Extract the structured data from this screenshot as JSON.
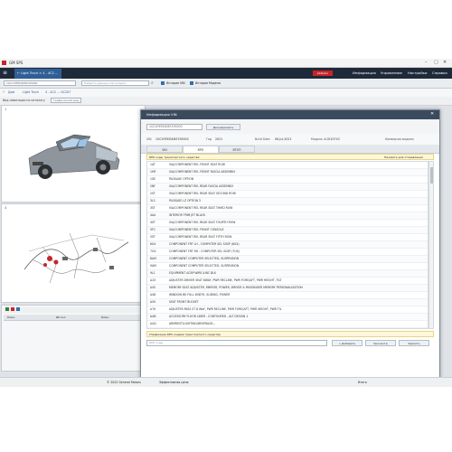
{
  "window": {
    "title": "GM SPS"
  },
  "nav": {
    "tab": "← Light Truck > 4 - 4C2 ...",
    "logo": "ACDelco",
    "items": [
      "Информация",
      "Управление",
      "Настройки",
      "Справка"
    ]
  },
  "toolbar": {
    "vin_value": "1GCUYEED4MZ195000",
    "search_placeholder": "Найдите данные или модели",
    "history_vin": "История VIN",
    "history_mode": "История Модели"
  },
  "breadcrumb": [
    "Дом",
    "Light Truck",
    "4 - 4C2 ... GC207"
  ],
  "view": {
    "label": "Вид навигации по каталогу",
    "value": "Графический вид"
  },
  "panes": {
    "num1": "1",
    "num2": "4"
  },
  "dialog": {
    "title": "Информация VIN",
    "vin_input": "1GCUYEED4MZ195000",
    "decode_button": "Декодировать",
    "info": {
      "vin_label": "VIN",
      "vin_value": "1GCUYEED4MZ195000",
      "year_label": "Год",
      "year_value": "2021",
      "build_label": "Build Date",
      "build_value": "06-Jul-2021",
      "model_label": "Модель",
      "model_value": "4-CK10743",
      "config_label": "Конверсия модели"
    },
    "tabs": [
      "VIN",
      "RPO",
      "ВТОП"
    ],
    "active_tab": 1,
    "yellow_top_text": "RPO коды транспортного средства",
    "yellow_top_right": "Нажмите для отправления",
    "rows": [
      {
        "code": "1AT",
        "desc": "VIA/COMPONENT REL FRONT SEAT ROW"
      },
      {
        "code": "1MF",
        "desc": "VIA/COMPONENT REL FRONT FASCIA ASSEMBLY"
      },
      {
        "code": "1SE",
        "desc": "PACKAGE OPTION"
      },
      {
        "code": "2NF",
        "desc": "VIA/COMPONENT REL REAR FASCIA ASSEMBLY"
      },
      {
        "code": "2ST",
        "desc": "VIA/COMPONENT REL REAR SEAT SECOND ROW"
      },
      {
        "code": "3L2",
        "desc": "PACKAGE LZ OPTION 3"
      },
      {
        "code": "3ST",
        "desc": "VIA/COMPONENT REL REAR SEAT THIRD ROW"
      },
      {
        "code": "4AA",
        "desc": "INTERIOR TRIM JET BLACK"
      },
      {
        "code": "4ST",
        "desc": "VIA/COMPONENT REL REAR SEAT FOURTH ROW"
      },
      {
        "code": "5FC",
        "desc": "VIA/COMPONENT REL FRONT CONSOLE"
      },
      {
        "code": "5ST",
        "desc": "VIA/COMPONENT REL REAR SEAT FIFTH ROW"
      },
      {
        "code": "6UX",
        "desc": "COMPONENT FRT LH - COMPUTER SEL SUSP (6UX)"
      },
      {
        "code": "7GX",
        "desc": "COMPONENT FRT RH - COMPUTER SEL SUSP (7UX)"
      },
      {
        "code": "8AM",
        "desc": "COMPONENT COMPUTER SELECTED, SUSPENSION"
      },
      {
        "code": "9AM",
        "desc": "COMPONENT COMPUTER SELECTED, SUSPENSION"
      },
      {
        "code": "9L1",
        "desc": "EQUIPMENT ACBP WIRE JUNC BLK"
      },
      {
        "code": "A2X",
        "desc": "ADJUSTER DRIVER SEAT 8WAY, PWR RECLINE, PWR FORE/AFT, PWR HEIGHT, TILT"
      },
      {
        "code": "A45",
        "desc": "MEMORY SEAT ADJUSTER, MIRROR, POWER, DRIVER & PASSENGER MEMORY PERSONALIZATION"
      },
      {
        "code": "A48",
        "desc": "WINDOW BK FULL WIDTH, SLIDING, POWER"
      },
      {
        "code": "A50",
        "desc": "SEAT FRONT BUCKET"
      },
      {
        "code": "A7X",
        "desc": "ADJUSTER PASS ST 8 WAY, PWR RECLINE, PWR FORE/AFT, PWR HEIGHT, PWR TIL"
      },
      {
        "code": "AAB",
        "desc": "ACCESSORY FLOOR LINER - CONTOURED - ALT DESIGN 1"
      },
      {
        "code": "AAQ",
        "desc": "ARMREST/LIGHTING/BEVERAGE..."
      }
    ],
    "yellow_bottom_text": "Управление RPO кодами транспортного средства",
    "bottom_input": "RPO коды",
    "buttons": [
      "+ Добавить",
      "Просмотр",
      "Удалить"
    ]
  },
  "bottom_grid": {
    "col1": "Ключ",
    "col2": "RP кол",
    "col3": "Ключ"
  },
  "status": {
    "copyright": "© 2022 General Motors",
    "center": "Эффективная цена",
    "right": "Итого"
  }
}
